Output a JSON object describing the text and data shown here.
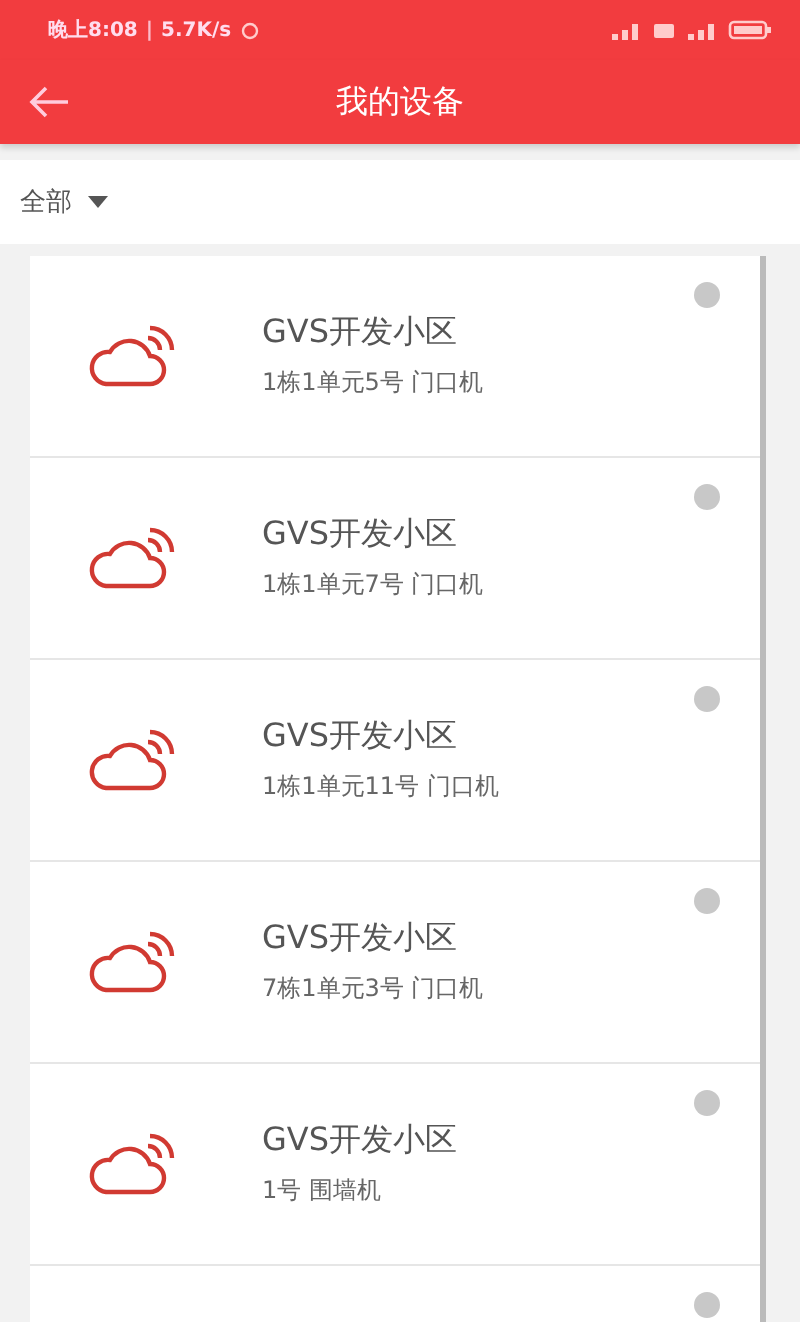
{
  "status_bar": {
    "time": "晚上8:08",
    "separator": "|",
    "speed": "5.7K/s"
  },
  "header": {
    "title": "我的设备"
  },
  "filter": {
    "label": "全部"
  },
  "devices": [
    {
      "name": "GVS开发小区",
      "location": "1栋1单元5号 门口机",
      "online": false
    },
    {
      "name": "GVS开发小区",
      "location": "1栋1单元7号 门口机",
      "online": false
    },
    {
      "name": "GVS开发小区",
      "location": "1栋1单元11号 门口机",
      "online": false
    },
    {
      "name": "GVS开发小区",
      "location": "7栋1单元3号 门口机",
      "online": false
    },
    {
      "name": "GVS开发小区",
      "location": "1号 围墙机",
      "online": false
    },
    {
      "online": false
    }
  ]
}
